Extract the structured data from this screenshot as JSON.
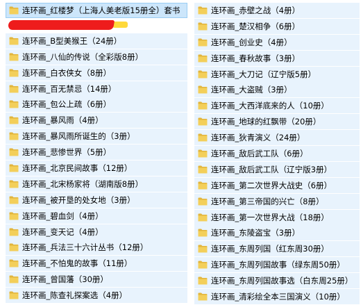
{
  "colors": {
    "row_background": "#e8f3fd",
    "selected_background": "#cce6fb",
    "folder_yellow": "#f3cf5a",
    "redaction_red": "#ee1c1c",
    "redaction_yellow": "#ffd93b"
  },
  "icon": "folder-icon",
  "left_column": [
    {
      "label": "连环画_红楼梦（上海人美老版15册全）套书",
      "selected": true,
      "redacted_below": true
    },
    {
      "label": "连环画_B型美猴王（24册）"
    },
    {
      "label": "连环画_八仙的传说（全彩版8册）"
    },
    {
      "label": "连环画_白衣侠女（8册）"
    },
    {
      "label": "连环画_百无禁忌（14册）"
    },
    {
      "label": "连环画_包公上疏（6册）"
    },
    {
      "label": "连环画_暴风雨（4册）"
    },
    {
      "label": "连环画_暴风雨所诞生的（3册）"
    },
    {
      "label": "连环画_悲惨世界（5册）"
    },
    {
      "label": "连环画_北京民间故事（12册）"
    },
    {
      "label": "连环画_北宋杨家将（湖南版8册）"
    },
    {
      "label": "连环画_被开垦的处女地（3册）"
    },
    {
      "label": "连环画_碧血剑（4册）"
    },
    {
      "label": "连环画_变天记（4册）"
    },
    {
      "label": "连环画_兵法三十六计丛书（12册）"
    },
    {
      "label": "连环画_不怕鬼的故事（11册）"
    },
    {
      "label": "连环画_曾国藩（30册）"
    },
    {
      "label": "连环画_陈查礼探案选（4册）"
    }
  ],
  "right_column": [
    {
      "label": "连环画_赤壁之战（4册）"
    },
    {
      "label": "连环画_楚汉相争（6册）"
    },
    {
      "label": "连环画_创业史（4册）"
    },
    {
      "label": "连环画_春秋故事（3册）"
    },
    {
      "label": "连环画_大刀记（辽宁版5册）"
    },
    {
      "label": "连环画_大盗贼（3册）"
    },
    {
      "label": "连环画_大西洋底来的人（10册）"
    },
    {
      "label": "连环画_地球的红飘带（20册）"
    },
    {
      "label": "连环画_狄青演义（24册）"
    },
    {
      "label": "连环画_敌后武工队（6册）"
    },
    {
      "label": "连环画_敌后武工队（辽宁版3册）"
    },
    {
      "label": "连环画_第二次世界大战史（6册）"
    },
    {
      "label": "连环画_第三帝国的兴亡（8册）"
    },
    {
      "label": "连环画_第一次世界大战（18册）"
    },
    {
      "label": "连环画_东陵盗宝（3册）"
    },
    {
      "label": "连环画_东周列国（红东周30册）"
    },
    {
      "label": "连环画_东周列国故事（绿东周50册）"
    },
    {
      "label": "连环画_东周列国故事选（白东周25册）"
    },
    {
      "label": "连环画_清彩绘全本三国演义（10册）"
    }
  ]
}
